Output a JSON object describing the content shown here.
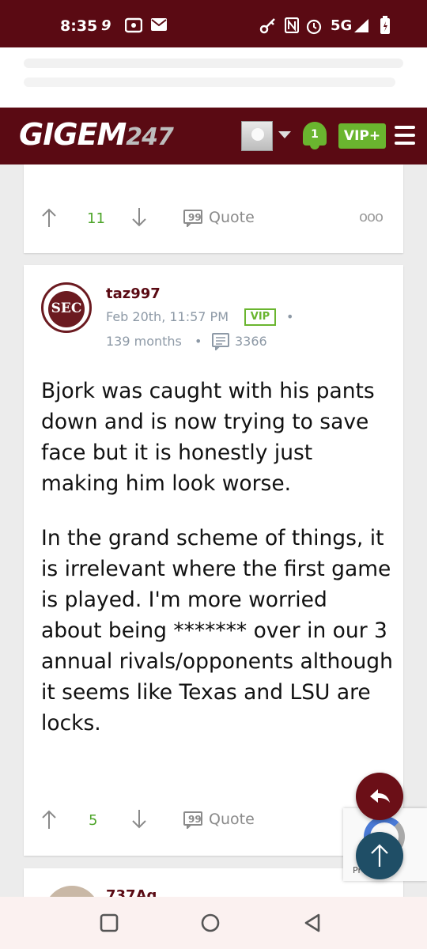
{
  "status_bar": {
    "time": "8:35",
    "network": "5G",
    "icons": [
      "game-icon",
      "radio-icon",
      "mail-icon",
      "key-icon",
      "nfc-icon",
      "alarm-icon",
      "signal-icon",
      "battery-icon"
    ]
  },
  "header": {
    "logo_main": "GIGEM",
    "logo_num": "247",
    "notifications_count": "1",
    "vip_label": "VIP+",
    "colors": {
      "maroon": "#5a0a13",
      "green": "#6ab52f"
    }
  },
  "previous_post": {
    "upvotes": "11",
    "quote_label": "Quote",
    "more_label": "ooo"
  },
  "post": {
    "username": "taz997",
    "avatar_text": "SEC",
    "timestamp": "Feb 20th, 11:57 PM",
    "vip_badge": "VIP",
    "separator": "•",
    "membership": "139 months",
    "post_count": "3366",
    "paragraph_1": "Bjork was caught with his pants down and is now trying to save face but it is honestly just making him look worse.",
    "paragraph_2": "In the grand scheme of things, it is irrelevant where the first game is played. I'm more worried about being ******* over in our 3 annual rivals/opponents although it seems like Texas and LSU are locks.",
    "upvotes": "5",
    "quote_label": "Quote",
    "more_label": "o"
  },
  "next_post": {
    "username_partial": "737Ag"
  },
  "recaptcha": {
    "links": "Pr    erms"
  },
  "nav": {
    "buttons": [
      "recents-button",
      "home-button",
      "back-button"
    ]
  }
}
